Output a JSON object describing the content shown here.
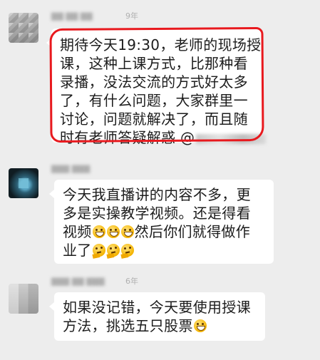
{
  "messages": [
    {
      "sender_suffix": "9年",
      "lines": [
        "期待今天19:30，老师的现场授",
        "课，这种上课方式，比那种看",
        "录播，没法交流的方式好太多",
        "了，有什么问题，大家群里一",
        "讨论，问题就解决了，而且随",
        "时有老师答疑解惑 @"
      ]
    },
    {
      "sender_suffix": "",
      "lines": [
        "今天我直播讲的内容不多，更",
        "多是实操教学视频。还是得看",
        "视频",
        "然后你们就得做作",
        "业了"
      ]
    },
    {
      "sender_suffix": "6年",
      "lines": [
        "如果没记错，今天要使用授课",
        "方法，挑选五只股票"
      ]
    }
  ],
  "emoji": {
    "grin": "grinning-face-icon",
    "think": "thinking-face-icon"
  },
  "colors": {
    "background": "#ededed",
    "bubble": "#ffffff",
    "highlight_ring": "#e8191e"
  }
}
